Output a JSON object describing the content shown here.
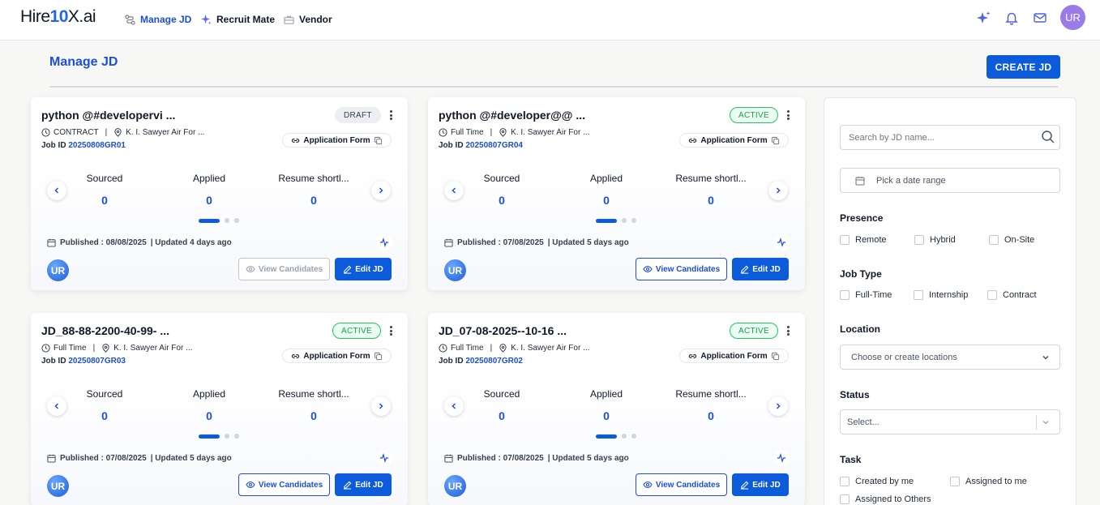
{
  "nav": {
    "logo_left": "Hire",
    "logo_ten": "10",
    "logo_right": "X.ai",
    "items": [
      {
        "label": "Manage JD",
        "icon": "flow-icon"
      },
      {
        "label": "Recruit Mate",
        "icon": "sparkle-icon"
      },
      {
        "label": "Vendor",
        "icon": "briefcase-icon"
      }
    ],
    "icons": [
      "ai-sparkle-icon",
      "bell-icon",
      "messages-icon"
    ],
    "avatar": "UR",
    "accent": "#1d4ed8"
  },
  "page": {
    "title": "Manage JD",
    "create_label": "CREATE JD"
  },
  "cards": [
    {
      "title": "python @#developervi ...",
      "status": "DRAFT",
      "type": "CONTRACT",
      "location": "K. I. Sawyer Air For ...",
      "job_id_label": "Job ID",
      "job_id": "20250808GR01",
      "app_form": "Application Form",
      "stats": [
        {
          "label": "Sourced",
          "value": "0"
        },
        {
          "label": "Applied",
          "value": "0"
        },
        {
          "label": "Resume shortl...",
          "value": "0"
        }
      ],
      "published": "Published : 08/08/2025",
      "updated": "| Updated 4 days ago",
      "avatar": "UR",
      "view_label": "View Candidates",
      "edit_label": "Edit JD"
    },
    {
      "title": "python @#developer@@ ...",
      "status": "ACTIVE",
      "type": "Full Time",
      "location": "K. I. Sawyer Air For ...",
      "job_id_label": "Job ID",
      "job_id": "20250807GR04",
      "app_form": "Application Form",
      "stats": [
        {
          "label": "Sourced",
          "value": "0"
        },
        {
          "label": "Applied",
          "value": "0"
        },
        {
          "label": "Resume shortl...",
          "value": "0"
        }
      ],
      "published": "Published : 07/08/2025",
      "updated": "| Updated 5 days ago",
      "avatar": "UR",
      "view_label": "View Candidates",
      "edit_label": "Edit JD"
    },
    {
      "title": "JD_88-88-2200-40-99- ...",
      "status": "ACTIVE",
      "type": "Full Time",
      "location": "K. I. Sawyer Air For ...",
      "job_id_label": "Job ID",
      "job_id": "20250807GR03",
      "app_form": "Application Form",
      "stats": [
        {
          "label": "Sourced",
          "value": "0"
        },
        {
          "label": "Applied",
          "value": "0"
        },
        {
          "label": "Resume shortl...",
          "value": "0"
        }
      ],
      "published": "Published : 07/08/2025",
      "updated": "| Updated 5 days ago",
      "avatar": "UR",
      "view_label": "View Candidates",
      "edit_label": "Edit JD"
    },
    {
      "title": "JD_07-08-2025--10-16 ...",
      "status": "ACTIVE",
      "type": "Full Time",
      "location": "K. I. Sawyer Air For ...",
      "job_id_label": "Job ID",
      "job_id": "20250807GR02",
      "app_form": "Application Form",
      "stats": [
        {
          "label": "Sourced",
          "value": "0"
        },
        {
          "label": "Applied",
          "value": "0"
        },
        {
          "label": "Resume shortl...",
          "value": "0"
        }
      ],
      "published": "Published : 07/08/2025",
      "updated": "| Updated 5 days ago",
      "avatar": "UR",
      "view_label": "View Candidates",
      "edit_label": "Edit JD"
    }
  ],
  "filters": {
    "search_placeholder": "Search by JD name...",
    "date_placeholder": "Pick a date range",
    "presence": {
      "label": "Presence",
      "options": [
        "Remote",
        "Hybrid",
        "On-Site"
      ]
    },
    "job_type": {
      "label": "Job Type",
      "options": [
        "Full-Time",
        "Internship",
        "Contract"
      ]
    },
    "location": {
      "label": "Location",
      "placeholder": "Choose or create locations"
    },
    "status": {
      "label": "Status",
      "placeholder": "Select..."
    },
    "task": {
      "label": "Task",
      "options": [
        "Created by me",
        "Assigned to me",
        "Assigned to Others"
      ]
    }
  }
}
